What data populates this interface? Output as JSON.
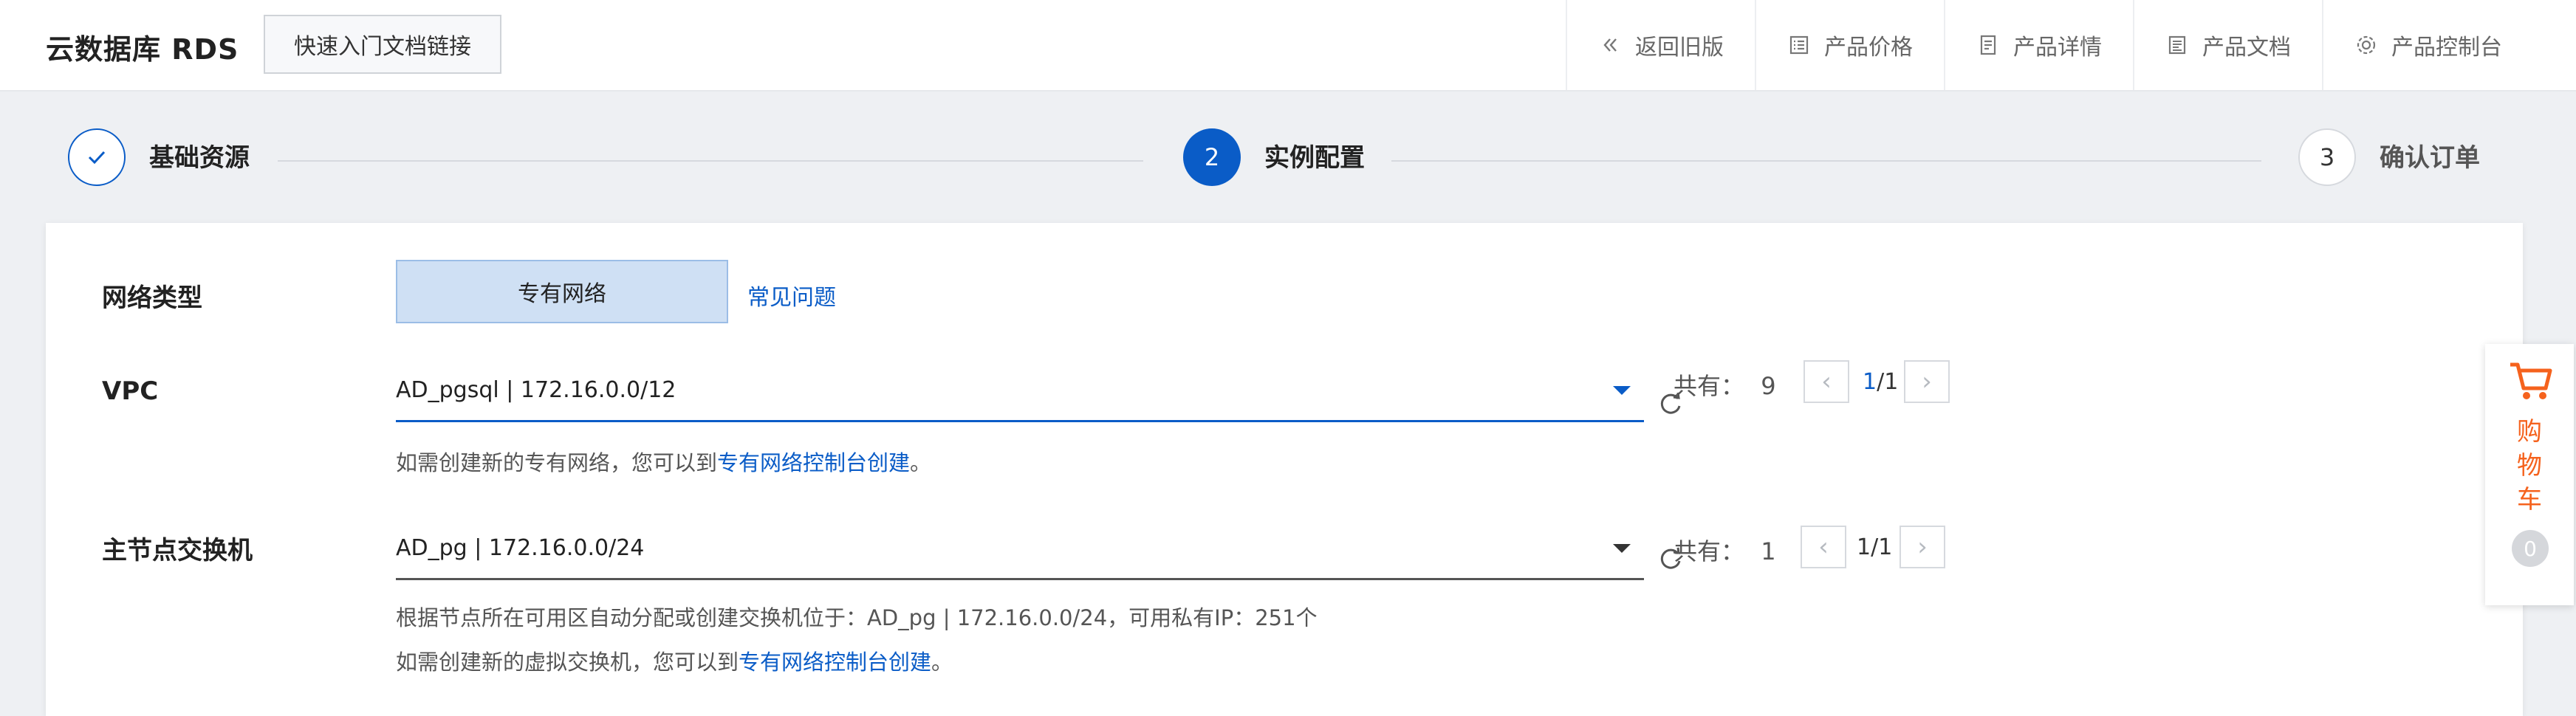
{
  "header": {
    "brand": "云数据库 RDS",
    "quick_link": "快速入门文档链接",
    "nav": [
      {
        "label": "返回旧版",
        "icon": "double-chevron-left-icon"
      },
      {
        "label": "产品价格",
        "icon": "price-list-icon"
      },
      {
        "label": "产品详情",
        "icon": "detail-doc-icon"
      },
      {
        "label": "产品文档",
        "icon": "document-icon"
      },
      {
        "label": "产品控制台",
        "icon": "gear-icon"
      }
    ]
  },
  "steps": [
    {
      "label": "基础资源",
      "state": "done"
    },
    {
      "label": "实例配置",
      "number": "2",
      "state": "active"
    },
    {
      "label": "确认订单",
      "number": "3",
      "state": "pending"
    }
  ],
  "form": {
    "network": {
      "label": "网络类型",
      "option": "专有网络",
      "faq": "常见问题"
    },
    "vpc": {
      "label": "VPC",
      "value": "AD_pgsql | 172.16.0.0/12",
      "total_label": "共有：",
      "total": "9",
      "page_current": "1",
      "page_sep": "/1",
      "hint_prefix": "如需创建新的专有网络，您可以到",
      "hint_link": "专有网络控制台创建",
      "hint_suffix": "。"
    },
    "vswitch": {
      "label": "主节点交换机",
      "value": "AD_pg | 172.16.0.0/24",
      "total_label": "共有：",
      "total": "1",
      "page": "1/1",
      "info": "根据节点所在可用区自动分配或创建交换机位于：AD_pg | 172.16.0.0/24，可用私有IP：251个",
      "hint_prefix": "如需创建新的虚拟交换机，您可以到",
      "hint_link": "专有网络控制台创建",
      "hint_suffix": "。"
    }
  },
  "cart": {
    "label": "购物车",
    "count": "0",
    "accent": "#f5621d"
  },
  "colors": {
    "primary": "#0a5cc7",
    "accent": "#f5621d"
  }
}
